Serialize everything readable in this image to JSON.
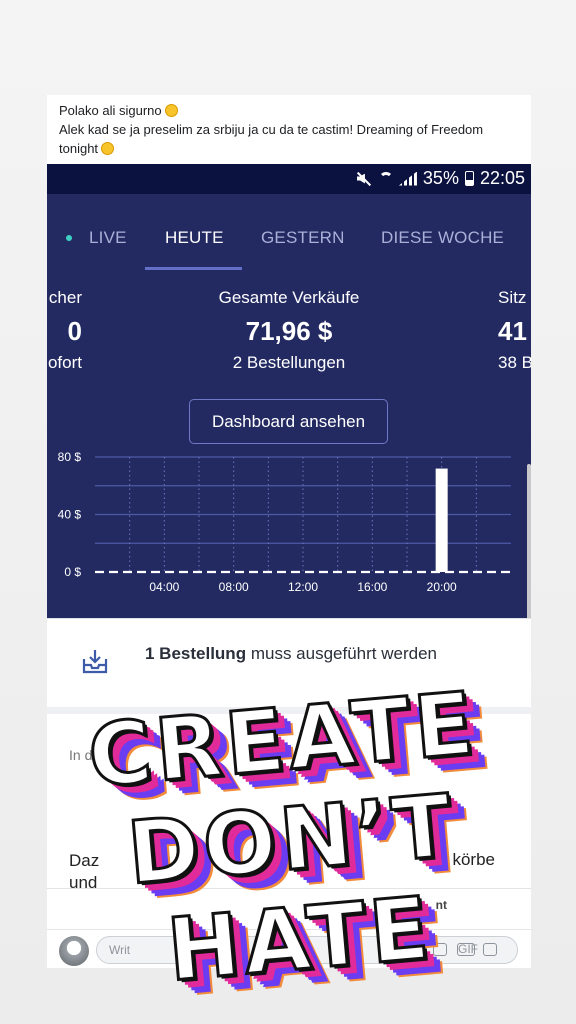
{
  "post": {
    "line1": "Polako ali sigurno",
    "line2": "Alek kad se ja preselim za srbiju ja cu da te castim! Dreaming of Freedom",
    "line3": "tonight"
  },
  "status_bar": {
    "battery": "35%",
    "time": "22:05"
  },
  "tabs": [
    {
      "label": "LIVE"
    },
    {
      "label": "HEUTE",
      "active": true
    },
    {
      "label": "GESTERN"
    },
    {
      "label": "DIESE WOCHE"
    }
  ],
  "metrics": {
    "left": {
      "label": "cher",
      "value": "0",
      "sub": "ofort"
    },
    "center": {
      "label": "Gesamte Verkäufe",
      "value": "71,96 $",
      "sub": "2 Bestellungen"
    },
    "right": {
      "label": "Sitz",
      "value": "41",
      "sub": "38 B"
    }
  },
  "dashboard_button": "Dashboard ansehen",
  "chart_data": {
    "type": "bar",
    "y_ticks": [
      "80 $",
      "40 $",
      "0 $"
    ],
    "ylim": [
      0,
      80
    ],
    "x_ticks": [
      "04:00",
      "08:00",
      "12:00",
      "16:00",
      "20:00"
    ],
    "hours": [
      20
    ],
    "values": [
      71.96
    ],
    "xlabel": "",
    "ylabel": "",
    "grid": true
  },
  "order_notice": {
    "bold": "1 Bestellung",
    "rest": "muss ausgeführt werden"
  },
  "lower": {
    "in_text": "In d",
    "daz": "Daz",
    "und": "und",
    "korbe": "körbe",
    "ent": "nt"
  },
  "comment": {
    "placeholder": "Writ",
    "gif": "GIF"
  },
  "sticker": {
    "line1": "CREATE",
    "line2": "DON’T",
    "line3": "HATE"
  },
  "colors": {
    "phone_bg": "#232a62",
    "status_bg": "#0c1240",
    "accent": "#6470c8",
    "live": "#3fd0c4"
  }
}
